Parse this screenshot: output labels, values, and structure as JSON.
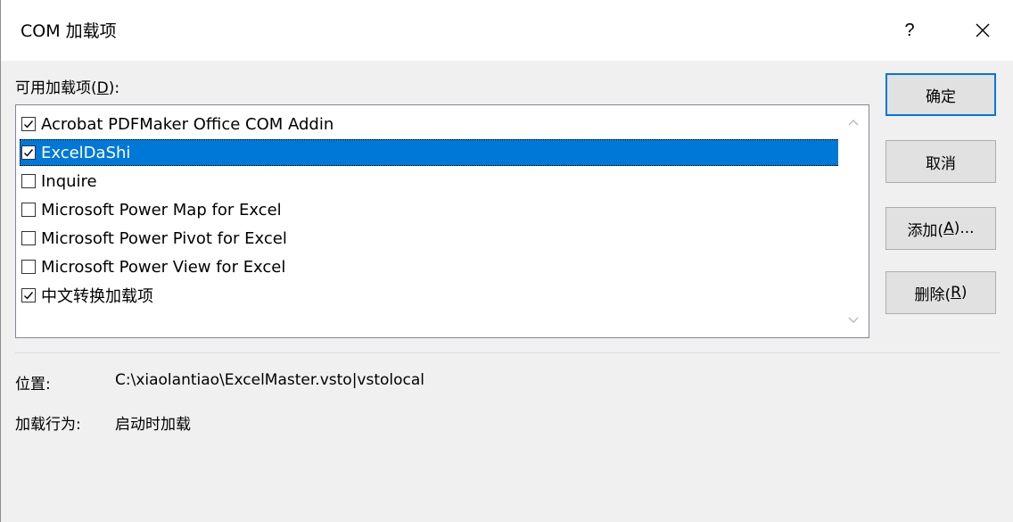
{
  "dialog": {
    "title": "COM 加载项",
    "help_glyph": "?",
    "close_glyph": "✕"
  },
  "addins": {
    "label_prefix": "可用加载项(",
    "label_accel": "D",
    "label_suffix": "):",
    "items": [
      {
        "label": "Acrobat PDFMaker Office COM Addin",
        "checked": true,
        "selected": false
      },
      {
        "label": "ExcelDaShi",
        "checked": true,
        "selected": true
      },
      {
        "label": "Inquire",
        "checked": false,
        "selected": false
      },
      {
        "label": "Microsoft Power Map for Excel",
        "checked": false,
        "selected": false
      },
      {
        "label": "Microsoft Power Pivot for Excel",
        "checked": false,
        "selected": false
      },
      {
        "label": "Microsoft Power View for Excel",
        "checked": false,
        "selected": false
      },
      {
        "label": "中文转换加载项",
        "checked": true,
        "selected": false
      }
    ]
  },
  "buttons": {
    "ok": "确定",
    "cancel": "取消",
    "add_prefix": "添加(",
    "add_accel": "A",
    "add_suffix": ")...",
    "remove_prefix": "删除(",
    "remove_accel": "R",
    "remove_suffix": ")"
  },
  "details": {
    "location_label": "位置:",
    "location_value": "C:\\xiaolantiao\\ExcelMaster.vsto|vstolocal",
    "behavior_label": "加载行为:",
    "behavior_value": "启动时加载"
  },
  "colors": {
    "selection": "#0078d7",
    "dialog_bg": "#f0f0f0",
    "button_bg": "#e1e1e1"
  }
}
